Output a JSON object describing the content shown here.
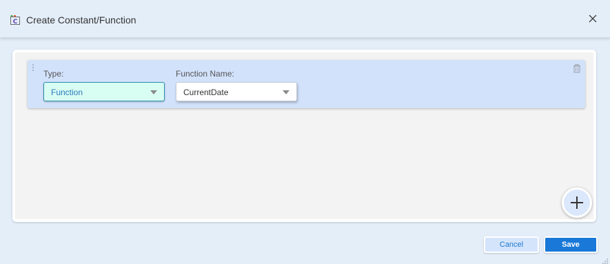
{
  "dialog": {
    "title": "Create Constant/Function",
    "icon": "constant-function-icon",
    "close_icon": "close-icon"
  },
  "row": {
    "type_label": "Type:",
    "type_value": "Function",
    "function_name_label": "Function Name:",
    "function_name_value": "CurrentDate",
    "delete_icon": "trash-icon",
    "drag_icon": "drag-handle-icon"
  },
  "add_icon": "plus-icon",
  "footer": {
    "cancel_label": "Cancel",
    "save_label": "Save"
  },
  "colors": {
    "accent": "#1a78d8",
    "row_background": "#d2e2fb",
    "type_select_background": "#d8fdf3",
    "dialog_background": "#e4eef9"
  }
}
